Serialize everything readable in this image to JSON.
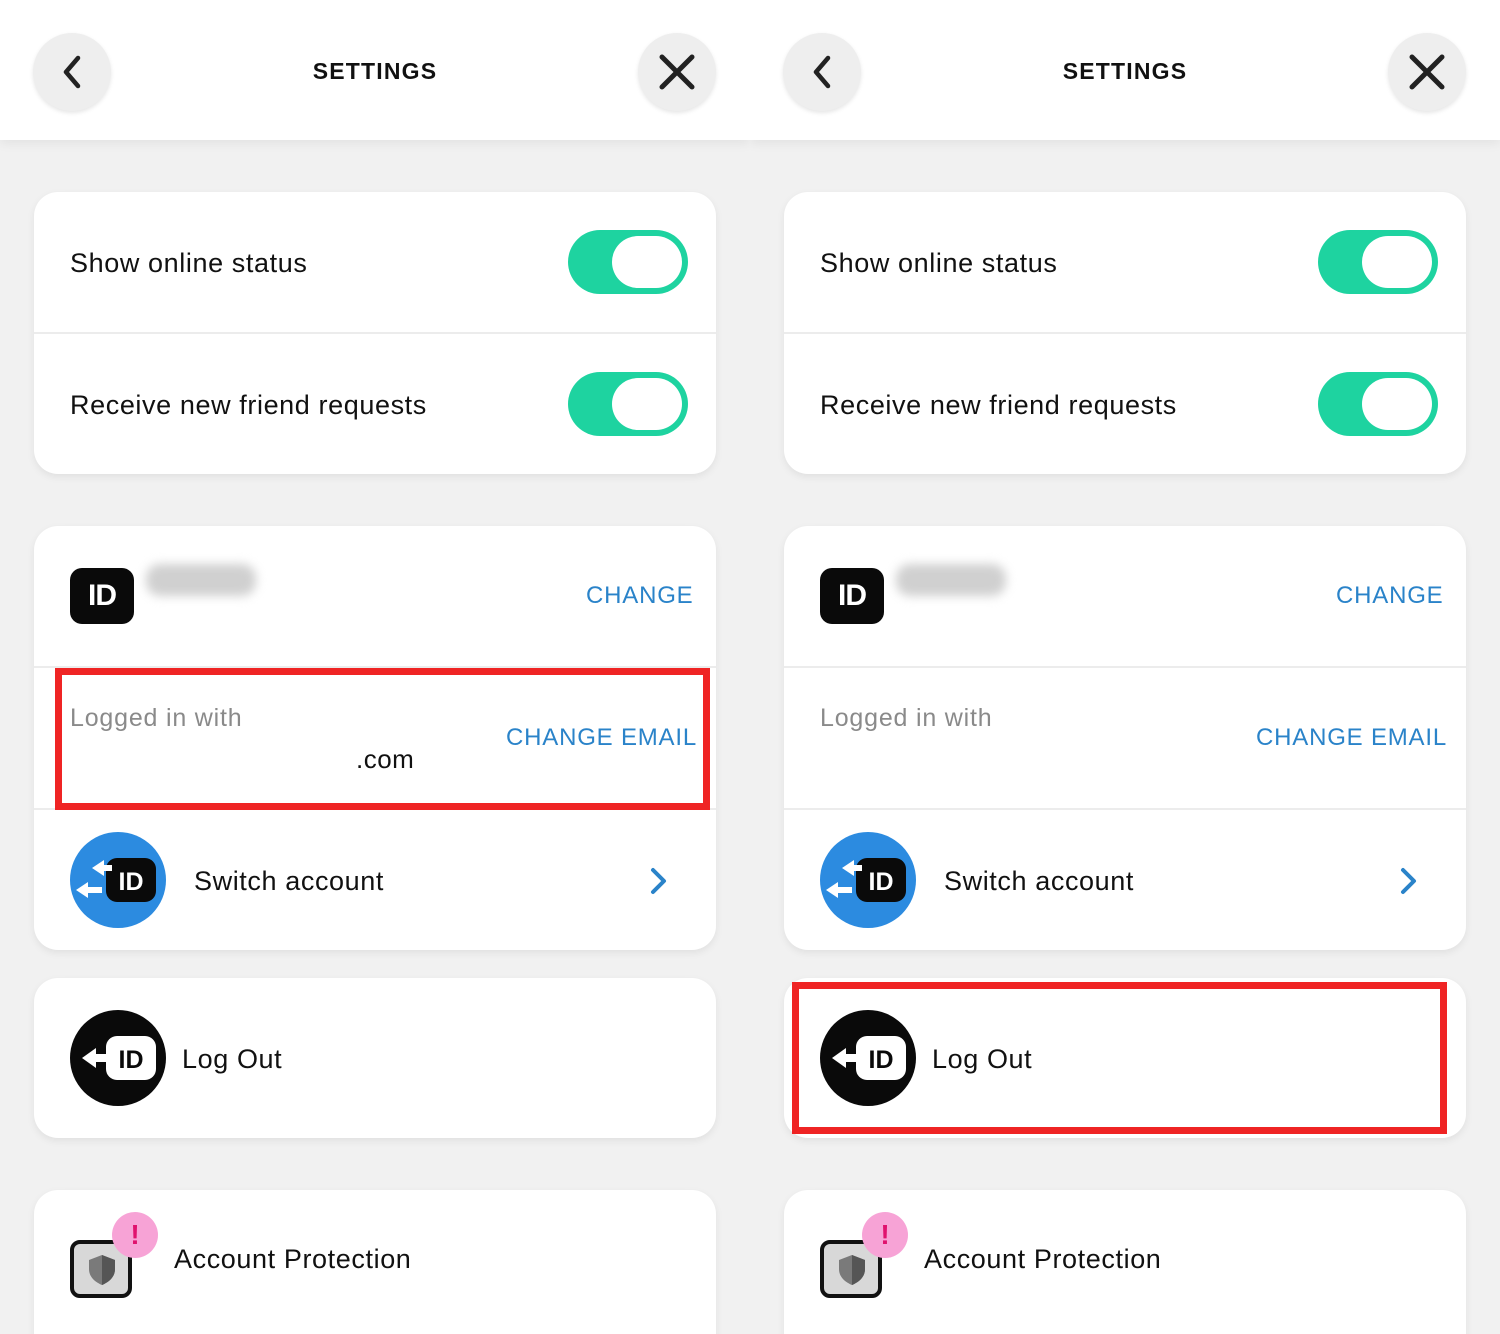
{
  "panels": [
    {
      "title": "SETTINGS",
      "toggles": [
        {
          "label": "Show online status",
          "on": true
        },
        {
          "label": "Receive new friend requests",
          "on": true
        }
      ],
      "account": {
        "id_logo": "ID",
        "change_label": "CHANGE",
        "logged_in_label": "Logged in with",
        "email_visible": ".com",
        "change_email_label": "CHANGE EMAIL",
        "switch_label": "Switch account"
      },
      "logout_label": "Log Out",
      "protection_label": "Account Protection",
      "alert_mark": "!"
    },
    {
      "title": "SETTINGS",
      "toggles": [
        {
          "label": "Show online status",
          "on": true
        },
        {
          "label": "Receive new friend requests",
          "on": true
        }
      ],
      "account": {
        "id_logo": "ID",
        "change_label": "CHANGE",
        "logged_in_label": "Logged in with",
        "email_visible": "",
        "change_email_label": "CHANGE EMAIL",
        "switch_label": "Switch account"
      },
      "logout_label": "Log Out",
      "protection_label": "Account Protection",
      "alert_mark": "!"
    }
  ],
  "colors": {
    "toggle_on": "#1ed3a0",
    "link": "#2a83c9",
    "highlight": "#ef2424",
    "switch_icon_bg": "#2c8be0",
    "alert_bg": "#f7a3d6"
  },
  "icons": {
    "back": "chevron-left-icon",
    "close": "close-icon",
    "switch": "switch-account-icon",
    "logout": "logout-icon",
    "shield": "shield-icon",
    "chevron": "chevron-right-icon"
  }
}
